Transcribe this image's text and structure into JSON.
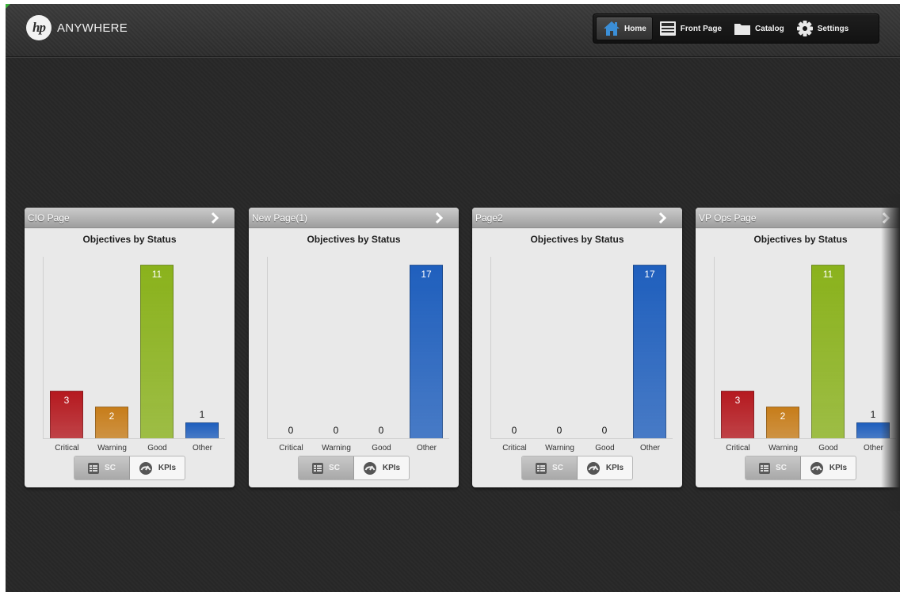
{
  "header": {
    "brand": "ANYWHERE",
    "logo_text": "hp",
    "nav": [
      {
        "label": "Home",
        "icon": "home-icon",
        "active": true
      },
      {
        "label": "Front Page",
        "icon": "front-page-icon",
        "active": false
      },
      {
        "label": "Catalog",
        "icon": "folder-icon",
        "active": false
      },
      {
        "label": "Settings",
        "icon": "gear-icon",
        "active": false
      }
    ]
  },
  "colors": {
    "Critical": "#b5191f",
    "Warning": "#c77d1a",
    "Good": "#8ab21c",
    "Other": "#1f5fbd"
  },
  "cards": [
    {
      "title": "CIO Page",
      "subtitle": "Objectives by Status",
      "toggle": {
        "sc": "SC",
        "kpis": "KPIs",
        "selected": "SC"
      }
    },
    {
      "title": "New Page(1)",
      "subtitle": "Objectives by Status",
      "toggle": {
        "sc": "SC",
        "kpis": "KPIs",
        "selected": "SC"
      }
    },
    {
      "title": "Page2",
      "subtitle": "Objectives by Status",
      "toggle": {
        "sc": "SC",
        "kpis": "KPIs",
        "selected": "SC"
      }
    },
    {
      "title": "VP Ops Page",
      "subtitle": "Objectives by Status",
      "toggle": {
        "sc": "SC",
        "kpis": "KPIs",
        "selected": "SC"
      }
    }
  ],
  "chart_data": [
    {
      "type": "bar",
      "title": "Objectives by Status",
      "categories": [
        "Critical",
        "Warning",
        "Good",
        "Other"
      ],
      "values": [
        3,
        2,
        11,
        1
      ],
      "ylim": [
        0,
        11
      ]
    },
    {
      "type": "bar",
      "title": "Objectives by Status",
      "categories": [
        "Critical",
        "Warning",
        "Good",
        "Other"
      ],
      "values": [
        0,
        0,
        0,
        17
      ],
      "ylim": [
        0,
        17
      ]
    },
    {
      "type": "bar",
      "title": "Objectives by Status",
      "categories": [
        "Critical",
        "Warning",
        "Good",
        "Other"
      ],
      "values": [
        0,
        0,
        0,
        17
      ],
      "ylim": [
        0,
        17
      ]
    },
    {
      "type": "bar",
      "title": "Objectives by Status",
      "categories": [
        "Critical",
        "Warning",
        "Good",
        "Other"
      ],
      "values": [
        3,
        2,
        11,
        1
      ],
      "ylim": [
        0,
        11
      ]
    }
  ]
}
